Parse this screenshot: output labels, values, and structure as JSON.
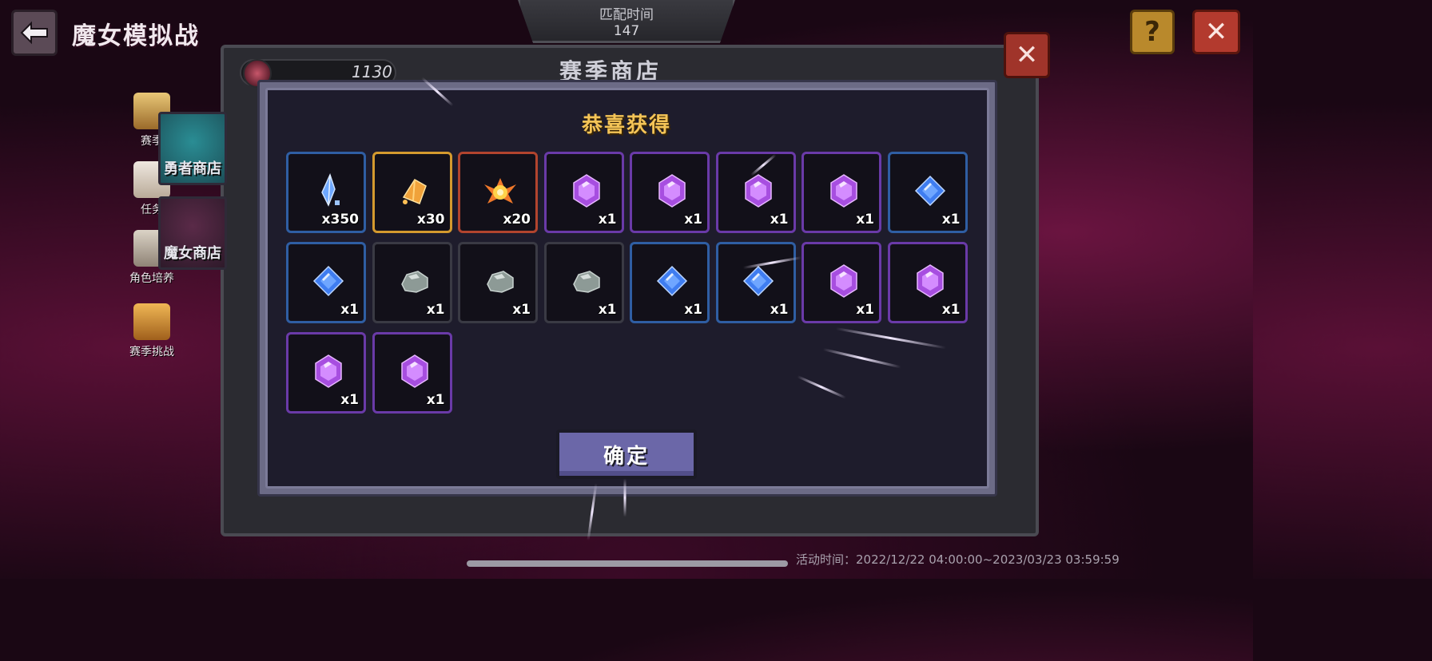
{
  "header": {
    "title": "魔女模拟战",
    "match": {
      "label": "匹配时间",
      "value": "147"
    },
    "help_label": "?",
    "close_label": "✕"
  },
  "side_menu": [
    {
      "label": "赛季",
      "icon": "chest-icon"
    },
    {
      "label": "任务",
      "icon": "feather-icon"
    },
    {
      "label": "角色培养",
      "icon": "shield-icon"
    },
    {
      "label": "赛季挑战",
      "icon": "scroll-icon"
    }
  ],
  "shop_tabs": [
    {
      "label": "勇者商店"
    },
    {
      "label": "魔女商店"
    }
  ],
  "shop": {
    "title": "赛季商店",
    "currency_value": "1130",
    "close_label": "✕"
  },
  "modal": {
    "title": "恭喜获得",
    "confirm_label": "确定",
    "items": [
      {
        "icon": "blue-crystal-icon",
        "rarity": "blue",
        "qty": "x350"
      },
      {
        "icon": "gold-ingot-icon",
        "rarity": "gold",
        "qty": "x30"
      },
      {
        "icon": "fire-orb-icon",
        "rarity": "red",
        "qty": "x20"
      },
      {
        "icon": "purple-gem-icon",
        "rarity": "purple",
        "qty": "x1"
      },
      {
        "icon": "purple-gem-icon",
        "rarity": "purple",
        "qty": "x1"
      },
      {
        "icon": "purple-gem-icon",
        "rarity": "purple",
        "qty": "x1"
      },
      {
        "icon": "purple-gem-icon",
        "rarity": "purple",
        "qty": "x1"
      },
      {
        "icon": "blue-gem-icon",
        "rarity": "blue",
        "qty": "x1"
      },
      {
        "icon": "blue-gem-icon",
        "rarity": "blue",
        "qty": "x1"
      },
      {
        "icon": "grey-stone-icon",
        "rarity": "dark",
        "qty": "x1"
      },
      {
        "icon": "grey-stone-icon",
        "rarity": "dark",
        "qty": "x1"
      },
      {
        "icon": "grey-stone-icon",
        "rarity": "dark",
        "qty": "x1"
      },
      {
        "icon": "blue-gem-icon",
        "rarity": "blue",
        "qty": "x1"
      },
      {
        "icon": "blue-gem-icon",
        "rarity": "blue",
        "qty": "x1"
      },
      {
        "icon": "purple-gem-icon",
        "rarity": "purple",
        "qty": "x1"
      },
      {
        "icon": "purple-gem-icon",
        "rarity": "purple",
        "qty": "x1"
      },
      {
        "icon": "purple-gem-icon",
        "rarity": "purple",
        "qty": "x1"
      },
      {
        "icon": "purple-gem-icon",
        "rarity": "purple",
        "qty": "x1"
      }
    ]
  },
  "footer": {
    "event_time": "活动时间：2022/12/22 04:00:00~2023/03/23 03:59:59"
  },
  "colors": {
    "title_gold": "#f4c457",
    "rarity_blue": "#2f5ea3",
    "rarity_purple": "#6a3aa8",
    "rarity_gold": "#d49a2e",
    "rarity_red": "#b2442e",
    "button_violet": "#6b67a8"
  }
}
